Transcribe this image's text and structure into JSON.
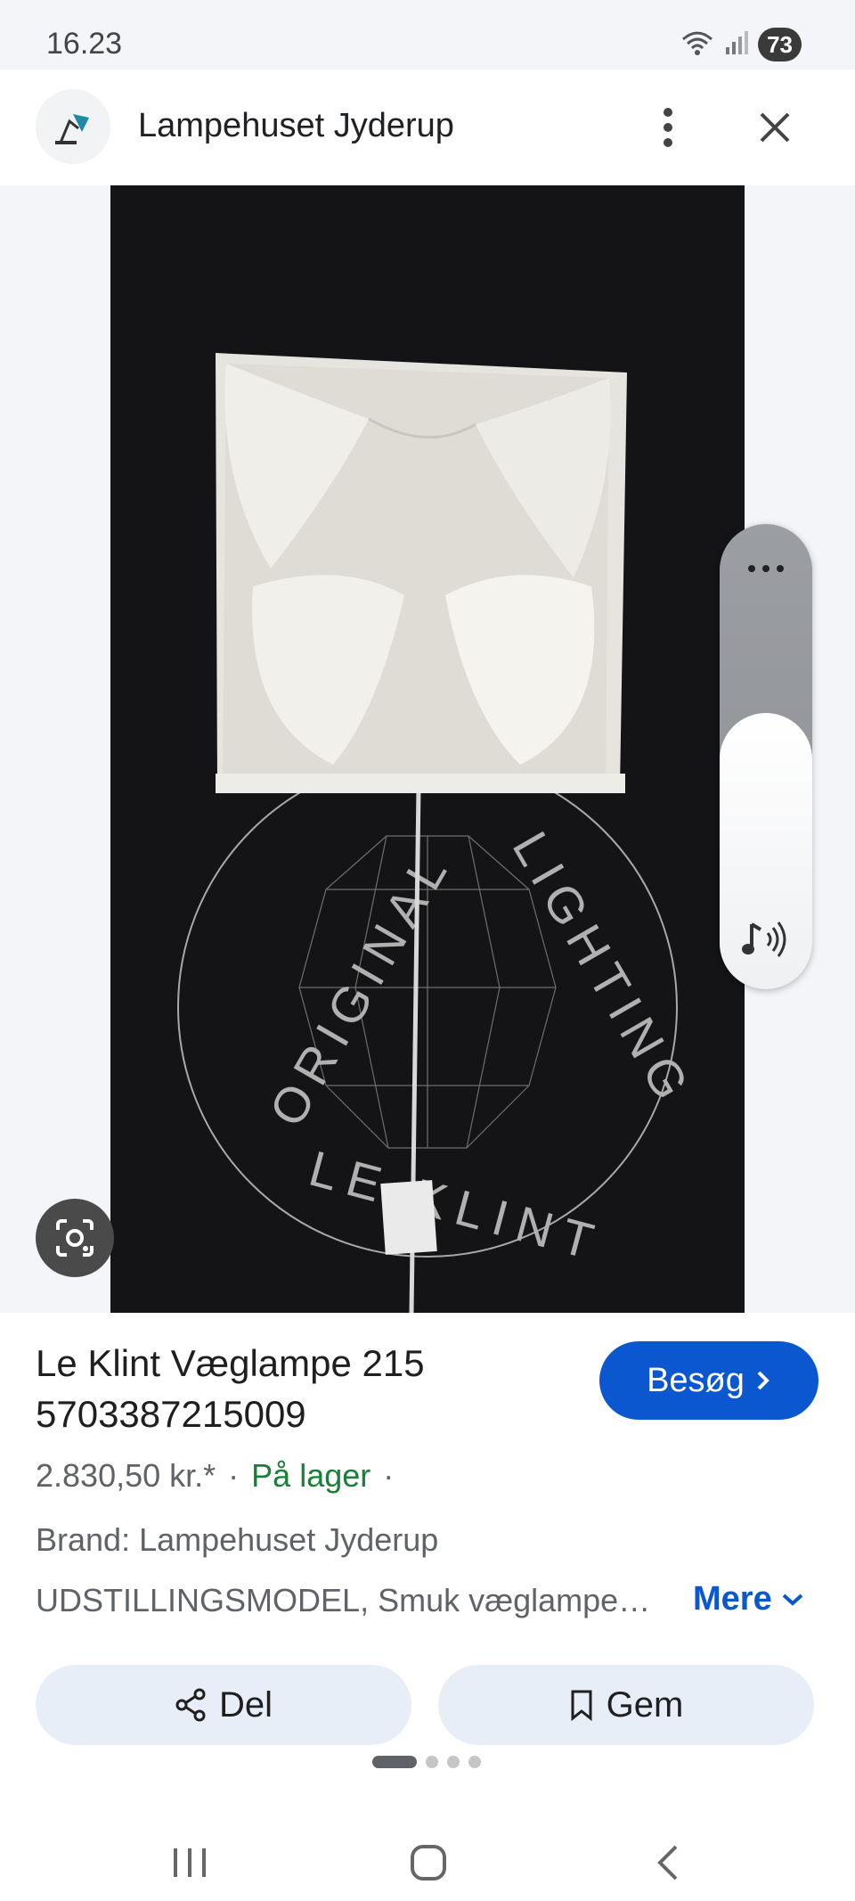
{
  "status": {
    "time": "16.23",
    "battery": "73"
  },
  "header": {
    "site_name": "Lampehuset Jyderup"
  },
  "image": {
    "alt": "Le Klint Væglampe 215"
  },
  "product": {
    "title": "Le Klint Væglampe 215 5703387215009",
    "price": "2.830,50 kr.*",
    "stock": "På lager",
    "separator": "·",
    "brand": "Brand: Lampehuset Jyderup",
    "description": "UDSTILLINGSMODEL, Smuk væglampe…",
    "more_label": "Mere",
    "visit_label": "Besøg"
  },
  "actions": {
    "share_label": "Del",
    "save_label": "Gem"
  },
  "carousel": {
    "count": 4,
    "active": 0
  },
  "colors": {
    "accent": "#0b57d0",
    "stock": "#188038",
    "chip": "#e8eef8"
  },
  "icons": [
    "wifi-icon",
    "signal-icon",
    "more-vert-icon",
    "close-icon",
    "lens-icon",
    "music-note-icon",
    "share-icon",
    "bookmark-icon",
    "chevron-right-icon",
    "chevron-down-icon",
    "recents-icon",
    "home-icon",
    "back-icon"
  ]
}
